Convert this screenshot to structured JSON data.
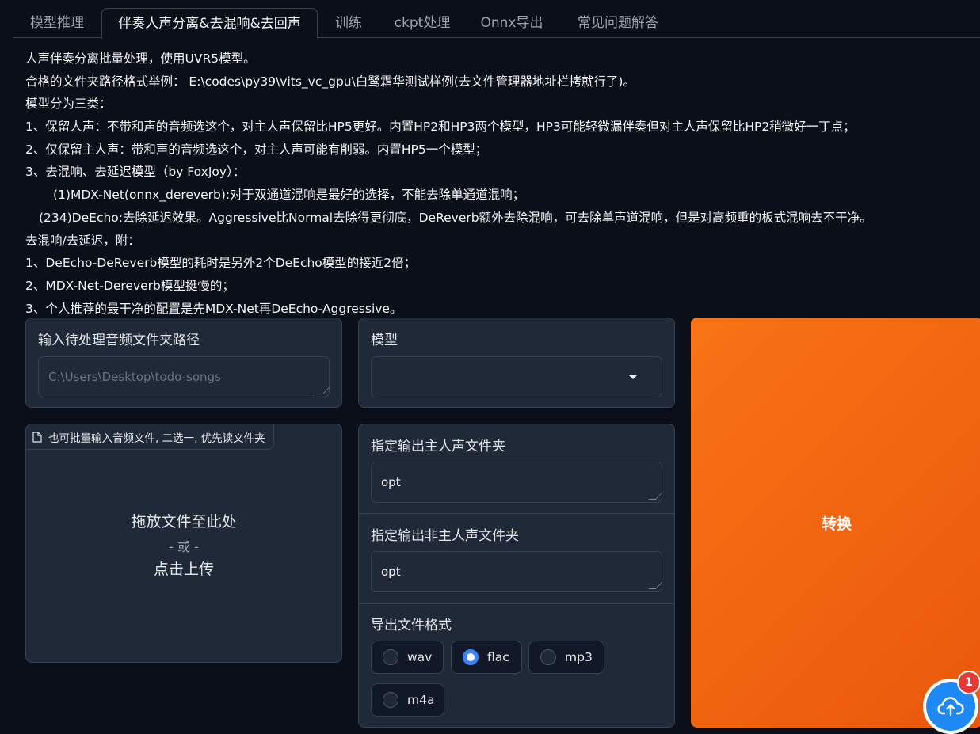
{
  "tabs": [
    {
      "label": "模型推理"
    },
    {
      "label": "伴奏人声分离&去混响&去回声",
      "active": true
    },
    {
      "label": "训练"
    },
    {
      "label": "ckpt处理"
    },
    {
      "label": "Onnx导出"
    },
    {
      "label": "常见问题解答"
    }
  ],
  "intro": {
    "lines": [
      "人声伴奏分离批量处理，使用UVR5模型。",
      "合格的文件夹路径格式举例：  E:\\codes\\py39\\vits_vc_gpu\\白鹭霜华测试样例(去文件管理器地址栏拷就行了)。",
      "模型分为三类：",
      "1、保留人声：不带和声的音频选这个，对主人声保留比HP5更好。内置HP2和HP3两个模型，HP3可能轻微漏伴奏但对主人声保留比HP2稍微好一丁点；",
      "2、仅保留主人声：带和声的音频选这个，对主人声可能有削弱。内置HP5一个模型；",
      "3、去混响、去延迟模型（by FoxJoy）：",
      "(1)MDX-Net(onnx_dereverb):对于双通道混响是最好的选择，不能去除单通道混响；",
      "(234)DeEcho:去除延迟效果。Aggressive比Normal去除得更彻底，DeReverb额外去除混响，可去除单声道混响，但是对高频重的板式混响去不干净。",
      "去混响/去延迟，附：",
      "1、DeEcho-DeReverb模型的耗时是另外2个DeEcho模型的接近2倍；",
      "2、MDX-Net-Dereverb模型挺慢的；",
      "3、个人推荐的最干净的配置是先MDX-Net再DeEcho-Aggressive。"
    ]
  },
  "input_dir": {
    "label": "输入待处理音频文件夹路径",
    "placeholder": "C:\\Users\\Desktop\\todo-songs"
  },
  "model": {
    "label": "模型",
    "value": ""
  },
  "upload": {
    "chip_label": "也可批量输入音频文件, 二选一, 优先读文件夹",
    "drop_text": "拖放文件至此处",
    "or_text": "- 或 -",
    "click_text": "点击上传"
  },
  "output_vocal": {
    "label": "指定输出主人声文件夹",
    "value": "opt"
  },
  "output_ins": {
    "label": "指定输出非主人声文件夹",
    "value": "opt"
  },
  "format": {
    "label": "导出文件格式",
    "options": [
      "wav",
      "flac",
      "mp3",
      "m4a"
    ],
    "selected": "flac"
  },
  "convert_button": {
    "label": "转换"
  },
  "fab": {
    "badge_count": "1",
    "icon": "cloud-upload-icon"
  },
  "colors": {
    "accent": "#f97316",
    "radio_selected": "#3b82f6",
    "background": "#0b0f19"
  }
}
